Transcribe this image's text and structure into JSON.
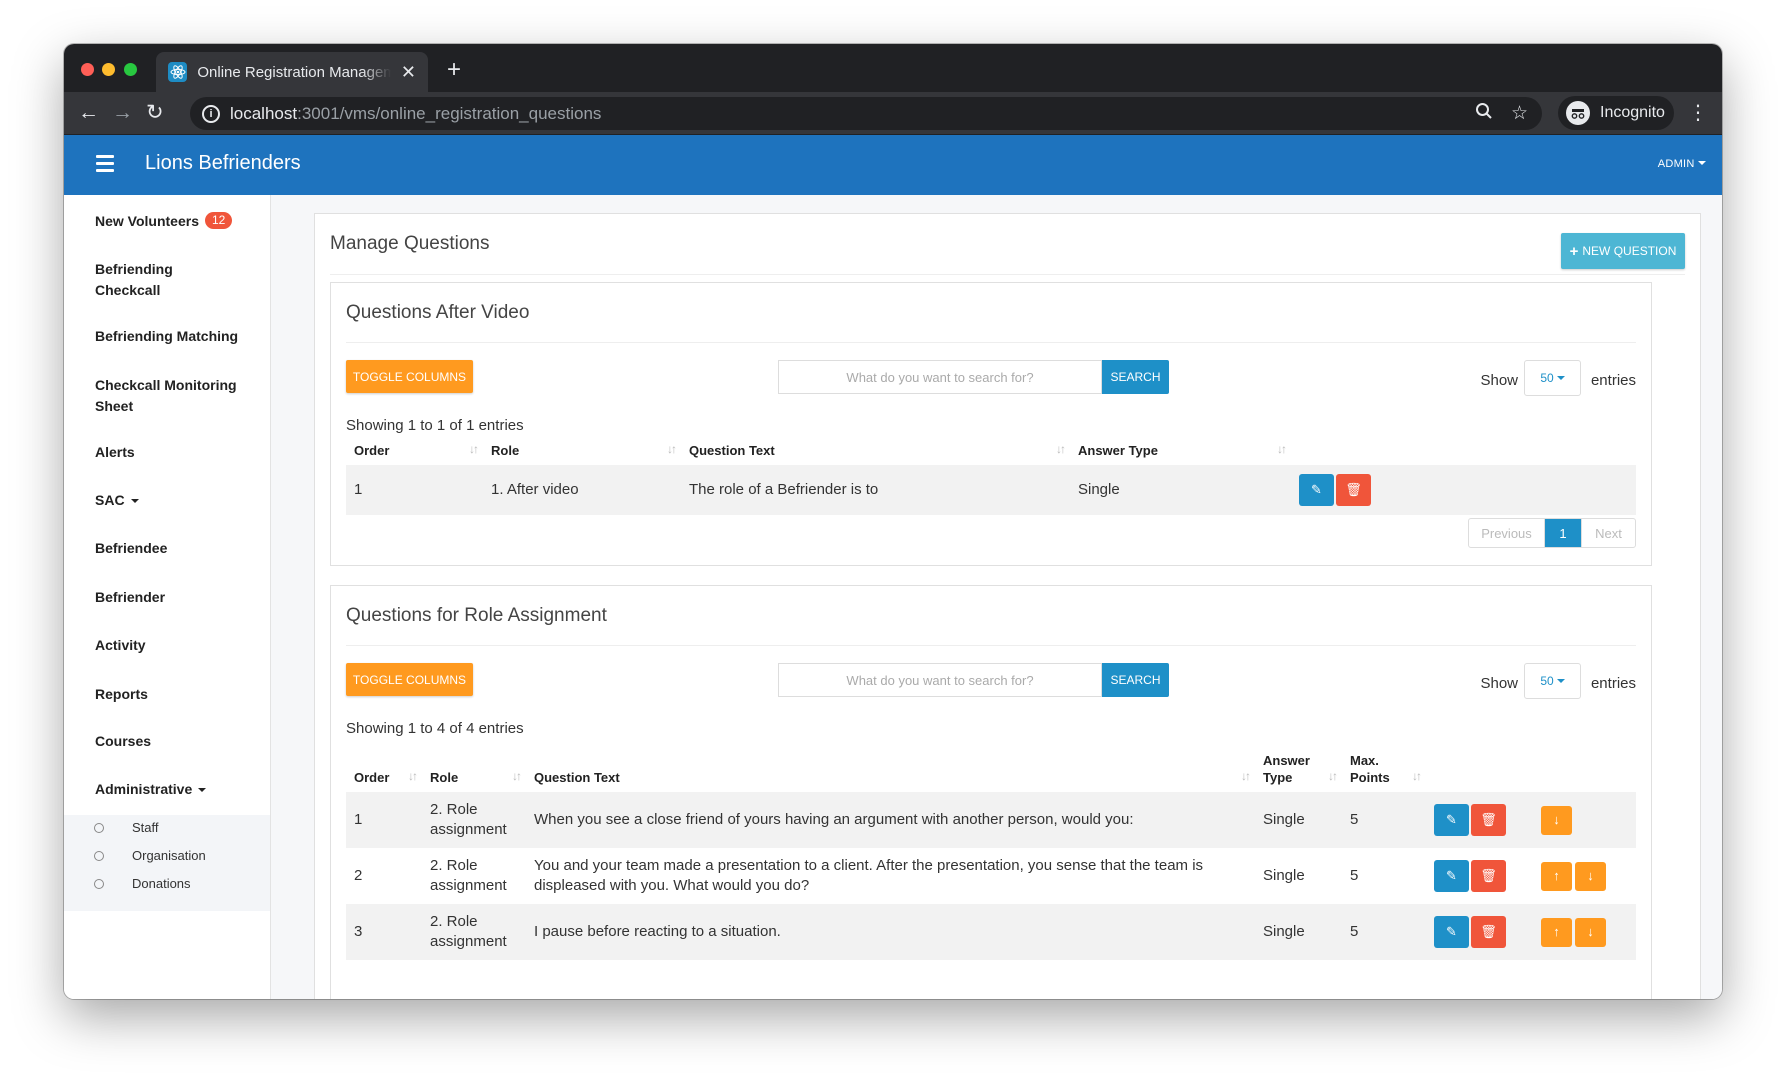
{
  "browser": {
    "tab_title": "Online Registration Management",
    "url_host": "localhost",
    "url_path": ":3001/vms/online_registration_questions",
    "profile_label": "Incognito"
  },
  "app": {
    "brand": "Lions Befrienders",
    "user_menu": "ADMIN",
    "header_color": "#1e73be"
  },
  "sidebar": {
    "items": [
      {
        "label": "New Volunteers",
        "badge": "12"
      },
      {
        "label": "Befriending\nCheckcall"
      },
      {
        "label": "Befriending Matching"
      },
      {
        "label": "Checkcall Monitoring\nSheet"
      },
      {
        "label": "Alerts"
      },
      {
        "label": "SAC"
      },
      {
        "label": "Befriendee"
      },
      {
        "label": "Befriender"
      },
      {
        "label": "Activity"
      },
      {
        "label": "Reports"
      },
      {
        "label": "Courses"
      },
      {
        "label": "Administrative"
      }
    ],
    "submenu": [
      "Staff",
      "Organisation",
      "Donations"
    ]
  },
  "page": {
    "title": "Manage Questions",
    "new_button": "NEW QUESTION"
  },
  "panel1": {
    "title": "Questions After Video",
    "toggle": "TOGGLE COLUMNS",
    "search_placeholder": "What do you want to search for?",
    "search_button": "SEARCH",
    "show": "Show",
    "page_size": "50",
    "entries": "entries",
    "showing": "Showing 1 to 1 of 1 entries",
    "columns": [
      "Order",
      "Role",
      "Question Text",
      "Answer Type"
    ],
    "rows": [
      {
        "order": "1",
        "role": "1. After video",
        "text": "The role of a Befriender is to",
        "type": "Single"
      }
    ],
    "pager": {
      "prev": "Previous",
      "current": "1",
      "next": "Next"
    }
  },
  "panel2": {
    "title": "Questions for Role Assignment",
    "toggle": "TOGGLE COLUMNS",
    "search_placeholder": "What do you want to search for?",
    "search_button": "SEARCH",
    "show": "Show",
    "page_size": "50",
    "entries": "entries",
    "showing": "Showing 1 to 4 of 4 entries",
    "columns": [
      "Order",
      "Role",
      "Question Text",
      "Answer\nType",
      "Max.\nPoints"
    ],
    "rows": [
      {
        "order": "1",
        "role": "2. Role assignment",
        "text": "When you see a close friend of yours having an argument with another person, would you:",
        "type": "Single",
        "points": "5"
      },
      {
        "order": "2",
        "role": "2. Role assignment",
        "text": "You and your team made a presentation to a client. After the presentation, you sense that the team is displeased with you. What would you do?",
        "type": "Single",
        "points": "5"
      },
      {
        "order": "3",
        "role": "2. Role assignment",
        "text": "I pause before reacting to a situation.",
        "type": "Single",
        "points": "5"
      }
    ]
  }
}
